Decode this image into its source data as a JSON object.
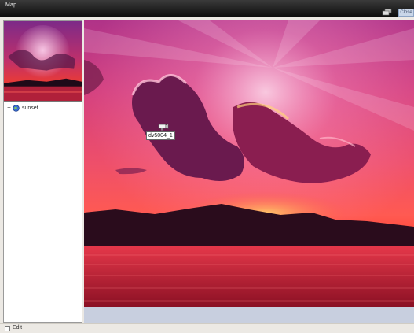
{
  "window": {
    "title": "Map"
  },
  "titlebar": {
    "icon": "layers-icon",
    "button_label": "Close"
  },
  "tree": {
    "expander": "+",
    "icon": "globe-icon",
    "items": [
      {
        "label": "sunset"
      }
    ]
  },
  "map": {
    "camera_icon": "camera-icon",
    "camera_label": "dv5004_1",
    "background": "sunset-photo"
  },
  "footer": {
    "edit_label": "Edit",
    "edit_checked": false
  },
  "colors": {
    "titlebar": "#111111",
    "accent": "#c9d6e8"
  }
}
